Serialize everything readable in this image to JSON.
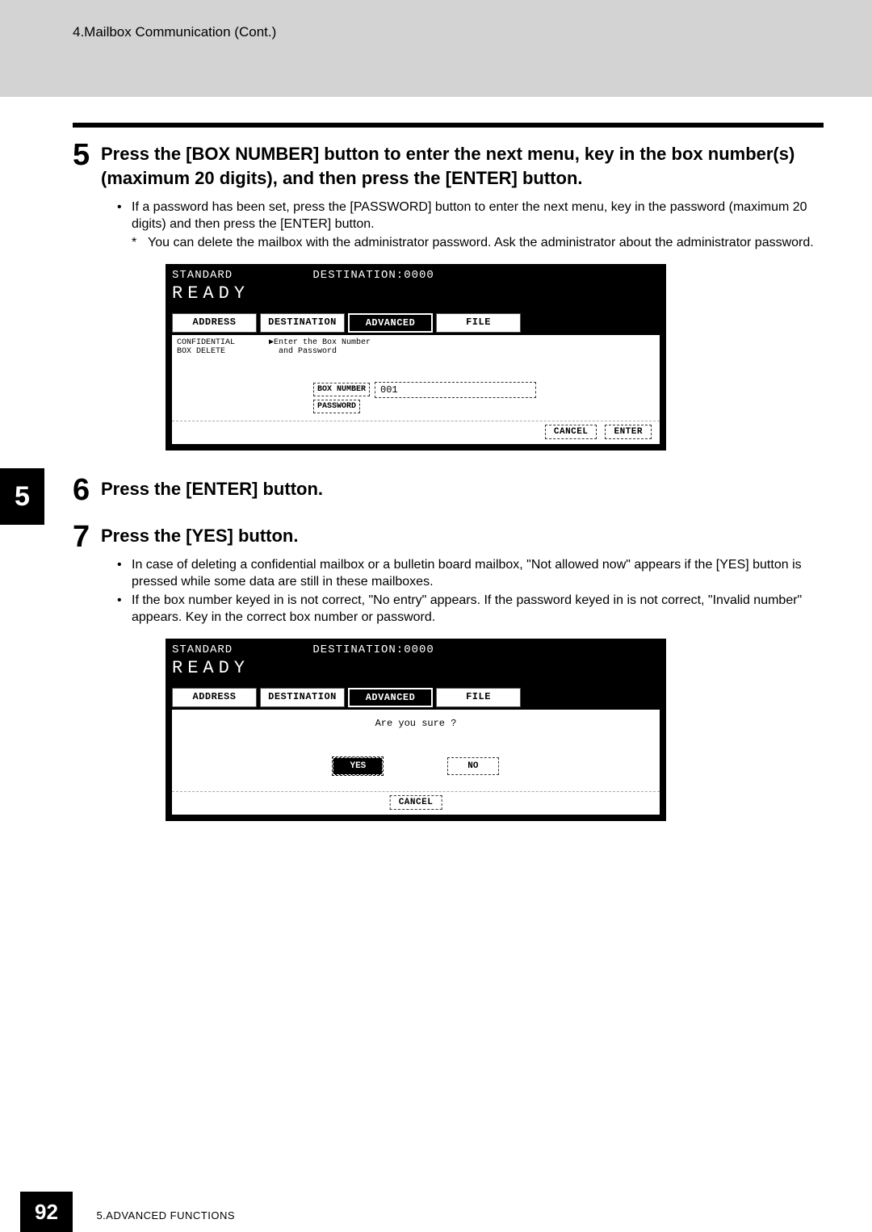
{
  "header": {
    "breadcrumb": "4.Mailbox Communication (Cont.)"
  },
  "side_tab": "5",
  "steps": {
    "s5": {
      "num": "5",
      "title": "Press the [BOX NUMBER] button to enter the next menu, key in the box number(s) (maximum 20 digits), and then press the [ENTER] button.",
      "b1": "If a password has been set, press the [PASSWORD] button to enter the next menu, key in the password (maximum 20 digits) and then press the [ENTER] button.",
      "sb1": "You can delete the mailbox with the administrator password. Ask the administrator about the administrator password."
    },
    "s6": {
      "num": "6",
      "title": "Press the [ENTER] button."
    },
    "s7": {
      "num": "7",
      "title": "Press the [YES] button.",
      "b1": "In case of deleting a confidential mailbox or a bulletin board mailbox, \"Not allowed now\" appears if the [YES] button is pressed while some data are still in these mailboxes.",
      "b2": "If the box number keyed in is not correct, \"No entry\" appears. If the password keyed in is not correct, \"Invalid number\" appears. Key in the correct box number or password."
    }
  },
  "screen1": {
    "mode": "STANDARD",
    "dest_label": "DESTINATION:0000",
    "ready": "READY",
    "tabs": {
      "t1": "ADDRESS",
      "t2": "DESTINATION",
      "t3": "ADVANCED",
      "t4": "FILE"
    },
    "left_label": "CONFIDENTIAL\nBOX DELETE",
    "instruction": "▶Enter the Box Number\n  and Password",
    "box_btn": "BOX NUMBER",
    "box_val": "001",
    "pwd_btn": "PASSWORD",
    "cancel": "CANCEL",
    "enter": "ENTER"
  },
  "screen2": {
    "mode": "STANDARD",
    "dest_label": "DESTINATION:0000",
    "ready": "READY",
    "tabs": {
      "t1": "ADDRESS",
      "t2": "DESTINATION",
      "t3": "ADVANCED",
      "t4": "FILE"
    },
    "confirm": "Are you sure ?",
    "yes": "YES",
    "no": "NO",
    "cancel": "CANCEL"
  },
  "footer": {
    "page": "92",
    "section": "5.ADVANCED FUNCTIONS"
  }
}
